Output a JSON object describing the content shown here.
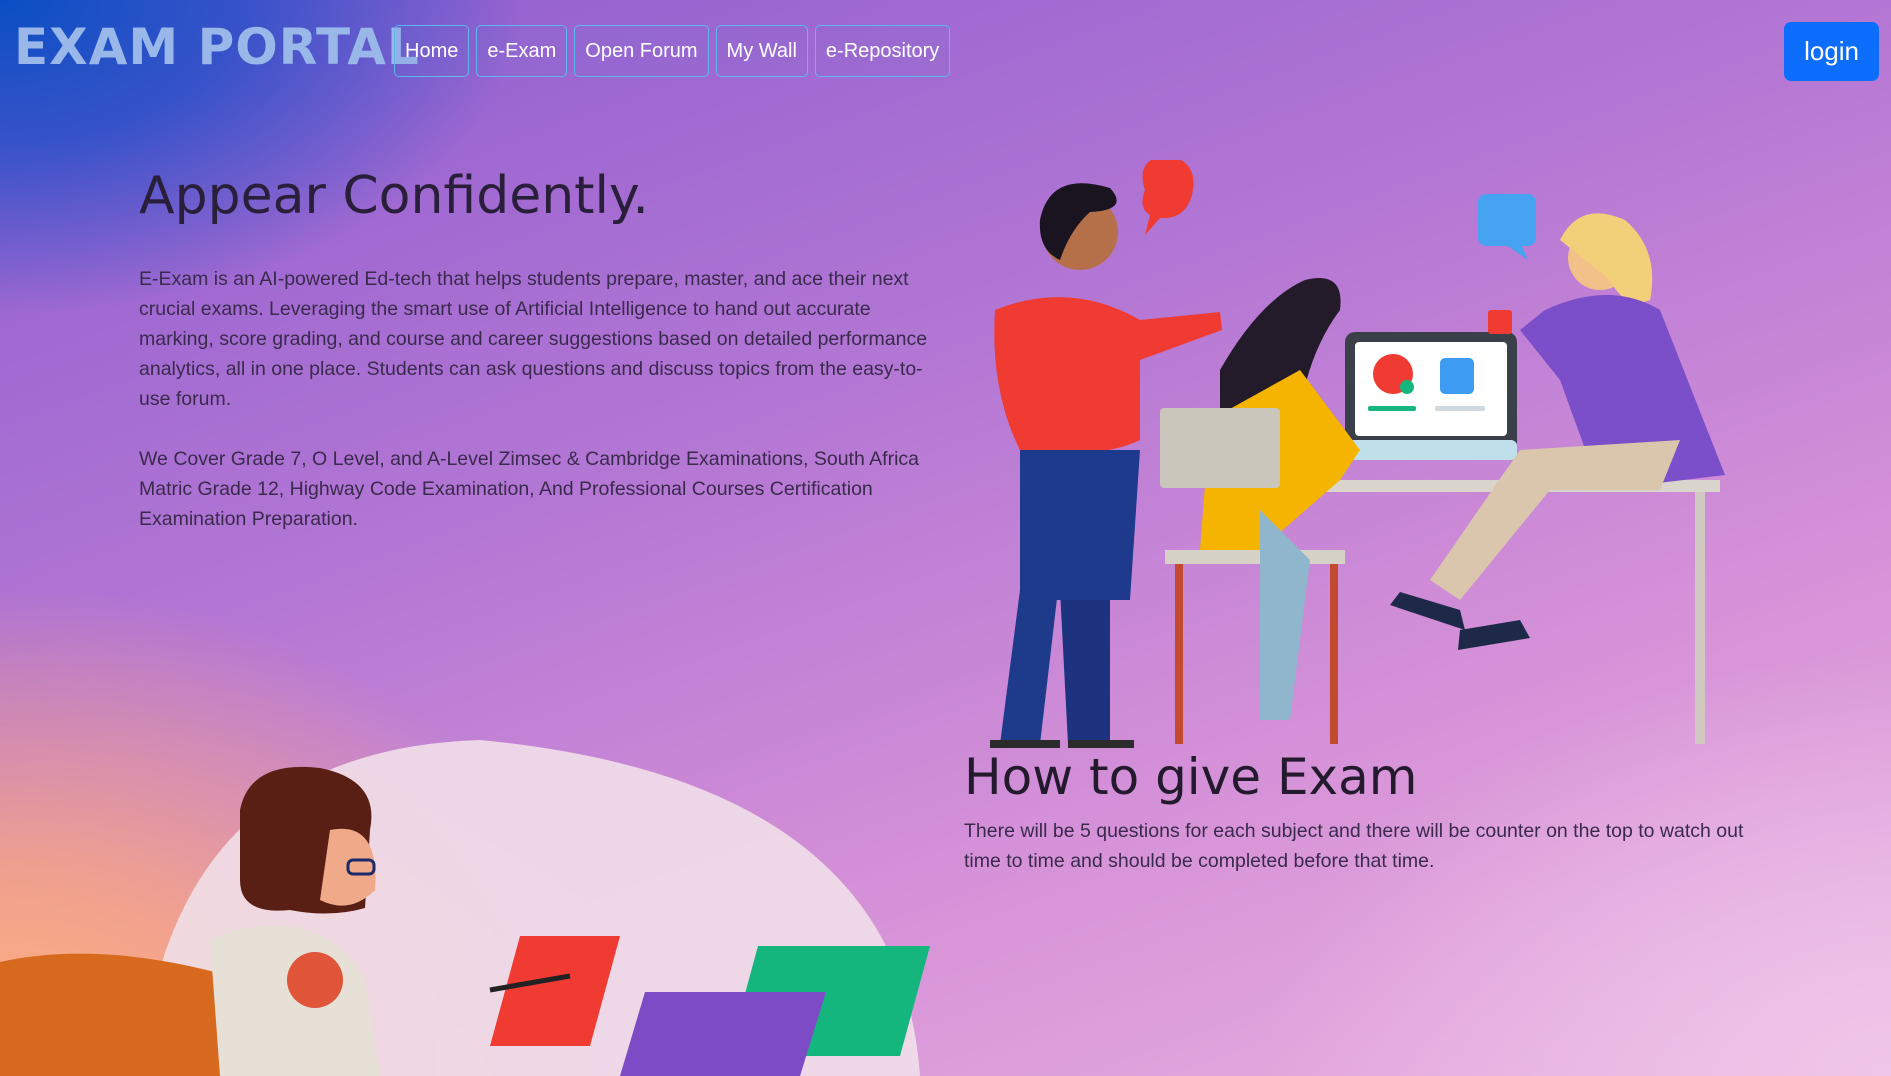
{
  "brand": "EXAM PORTAL",
  "nav": [
    "Home",
    "e-Exam",
    "Open Forum",
    "My Wall",
    "e-Repository"
  ],
  "login_label": "login",
  "hero": {
    "title": "Appear Confidently.",
    "paragraph1": "E-Exam is an AI-powered Ed-tech that helps students prepare, master, and ace their next crucial exams. Leveraging the smart use of Artificial Intelligence to hand out accurate marking, score grading, and course and career suggestions based on detailed performance analytics, all in one place. Students can ask questions and discuss topics from the easy-to-use forum.",
    "paragraph2": "We Cover Grade 7, O Level, and A-Level Zimsec & Cambridge Examinations, South Africa Matric Grade 12, Highway Code Examination, And Professional Courses Certification Examination Preparation."
  },
  "how": {
    "title": "How to give Exam",
    "text": "There will be 5 questions for each subject and there will be counter on the top to watch out time to time and should be completed before that time."
  },
  "colors": {
    "accent": "#0d6efd",
    "nav_border": "#5fb7f0",
    "brand_text": "#9ab7ea"
  }
}
